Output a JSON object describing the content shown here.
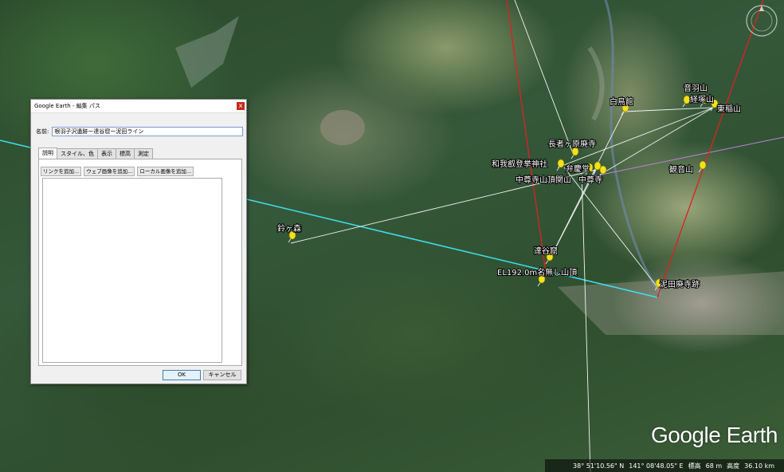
{
  "map": {
    "placemarks": [
      {
        "id": "suzugamori",
        "label": "鈴ヶ森"
      },
      {
        "id": "hakubakan",
        "label": "白鳥館"
      },
      {
        "id": "otowayama",
        "label": "音羽山"
      },
      {
        "id": "kyozukayama",
        "label": "経塚山"
      },
      {
        "id": "higashiinariyama",
        "label": "東稲山"
      },
      {
        "id": "chojagahara",
        "label": "長者ヶ原廃寺"
      },
      {
        "id": "wagahiko",
        "label": "和我叡登挙神社"
      },
      {
        "id": "benkeido",
        "label": "弁慶堂"
      },
      {
        "id": "chusonji_seki",
        "label": "中尊寺山頂関山"
      },
      {
        "id": "chusonji",
        "label": "中尊寺"
      },
      {
        "id": "kannonyama",
        "label": "観音山"
      },
      {
        "id": "takkokunoiwaya",
        "label": "達谷窟"
      },
      {
        "id": "nanashi",
        "label": "EL192.0m名無し山頂"
      },
      {
        "id": "deitahaiji",
        "label": "泥田廃寺跡"
      }
    ],
    "line_colors": {
      "cyan": "#3fe0f0",
      "red": "#e02020",
      "white": "#f4f4f4",
      "violet": "#c080e0",
      "pin": "#f2e21a"
    }
  },
  "branding": {
    "logo_google": "Google",
    "logo_earth": "Earth"
  },
  "status": {
    "lat": "38° 51'10.56\" N",
    "lon": "141° 08'48.05\" E",
    "elev_label": "標高",
    "elev_value": "68 m",
    "alt_label": "高度",
    "alt_value": "36.10 km"
  },
  "dialog": {
    "title": "Google Earth - 編集 パス",
    "close": "x",
    "name_label": "名前:",
    "name_value": "根羽子沢遺跡ー達谷窟ー泥田ライン",
    "tabs": [
      "説明",
      "スタイル、色",
      "表示",
      "標高",
      "測定"
    ],
    "buttons": {
      "add_link": "リンクを追加...",
      "add_web_image": "ウェブ画像を追加...",
      "add_local_image": "ローカル画像を追加..."
    },
    "ok": "OK",
    "cancel": "キャンセル"
  }
}
